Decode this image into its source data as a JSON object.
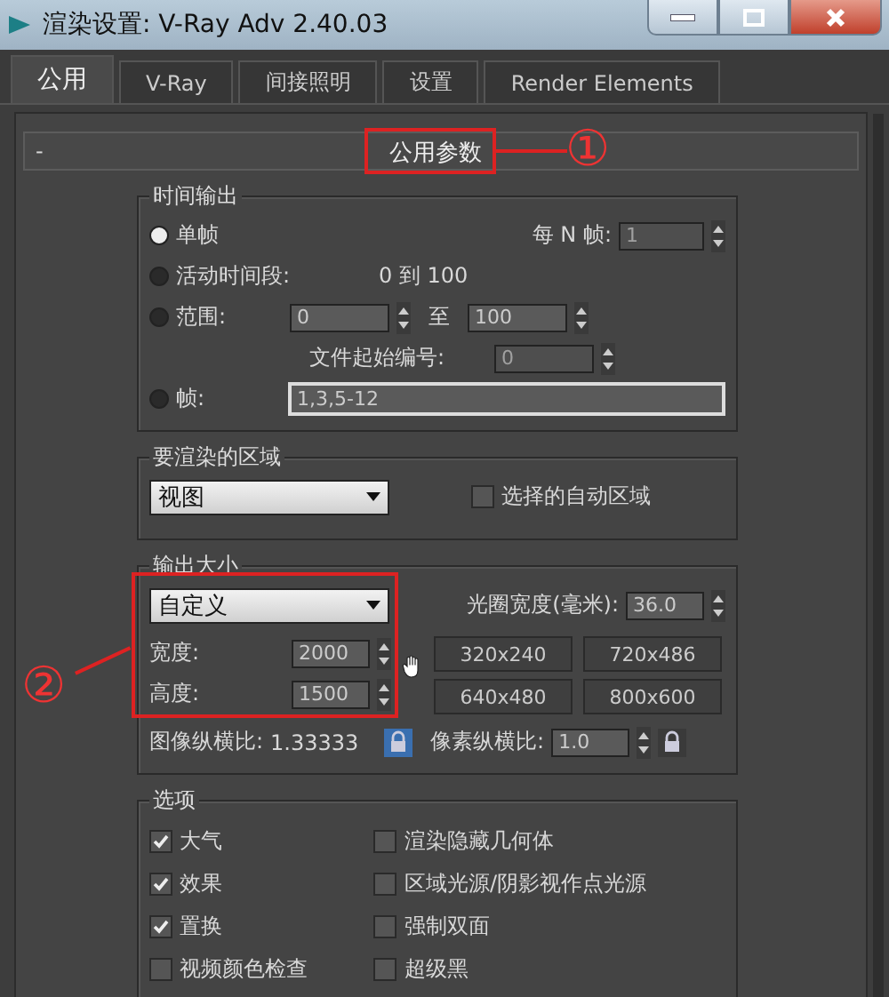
{
  "window": {
    "title": "渲染设置: V-Ray Adv 2.40.03"
  },
  "tabs": [
    {
      "label": "公用",
      "selected": true
    },
    {
      "label": "V-Ray",
      "selected": false
    },
    {
      "label": "间接照明",
      "selected": false
    },
    {
      "label": "设置",
      "selected": false
    },
    {
      "label": "Render Elements",
      "selected": false
    }
  ],
  "rollout": {
    "collapse_symbol": "-",
    "title": "公用参数"
  },
  "annotations": [
    {
      "label": "①"
    },
    {
      "label": "②"
    }
  ],
  "time_output": {
    "title": "时间输出",
    "single": {
      "label": "单帧",
      "selected": true
    },
    "every_n": {
      "label": "每 N 帧:",
      "value": "1",
      "disabled": true
    },
    "active": {
      "label": "活动时间段:",
      "selected": false,
      "value": "0 到 100"
    },
    "range": {
      "label": "范围:",
      "selected": false,
      "from": "0",
      "to_label": "至",
      "to": "100"
    },
    "file_start": {
      "label": "文件起始编号:",
      "value": "0",
      "disabled": true
    },
    "frames": {
      "label": "帧:",
      "selected": false,
      "value": "1,3,5-12"
    }
  },
  "area": {
    "title": "要渲染的区域",
    "dropdown": "视图",
    "auto_region": {
      "label": "选择的自动区域",
      "checked": false
    }
  },
  "output_size": {
    "title": "输出大小",
    "dropdown": "自定义",
    "aperture": {
      "label": "光圈宽度(毫米):",
      "value": "36.0"
    },
    "width": {
      "label": "宽度:",
      "value": "2000"
    },
    "height": {
      "label": "高度:",
      "value": "1500"
    },
    "presets": [
      "320x240",
      "720x486",
      "640x480",
      "800x600"
    ],
    "image_aspect": {
      "label": "图像纵横比:",
      "value": "1.33333",
      "locked": true
    },
    "pixel_aspect": {
      "label": "像素纵横比:",
      "value": "1.0",
      "locked": false
    }
  },
  "options": {
    "title": "选项",
    "columns": [
      [
        {
          "label": "大气",
          "checked": true
        },
        {
          "label": "效果",
          "checked": true
        },
        {
          "label": "置换",
          "checked": true
        },
        {
          "label": "视频颜色检查",
          "checked": false
        }
      ],
      [
        {
          "label": "渲染隐藏几何体",
          "checked": false
        },
        {
          "label": "区域光源/阴影视作点光源",
          "checked": false
        },
        {
          "label": "强制双面",
          "checked": false
        },
        {
          "label": "超级黑",
          "checked": false
        }
      ]
    ]
  }
}
